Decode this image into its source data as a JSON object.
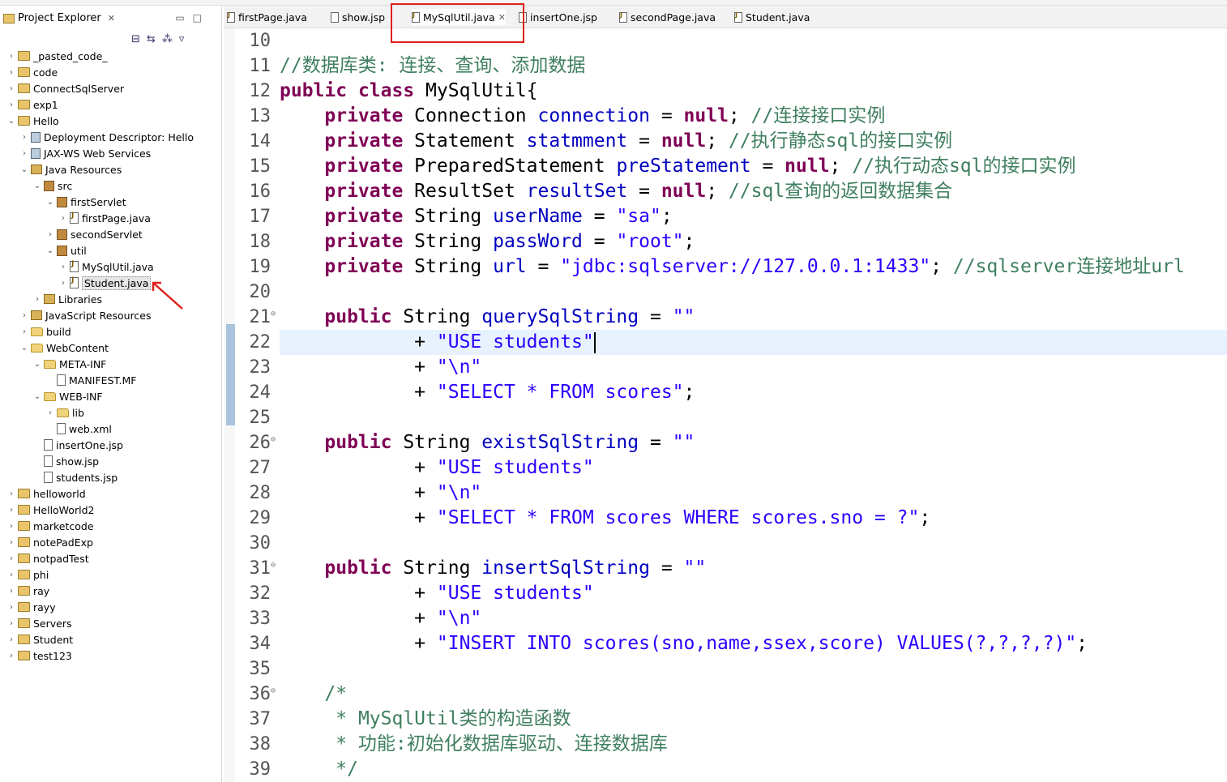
{
  "explorer": {
    "title": "Project Explorer",
    "items": [
      {
        "label": "_pasted_code_",
        "depth": 0,
        "icon": "project-icon",
        "expanded": false
      },
      {
        "label": "code",
        "depth": 0,
        "icon": "project-icon",
        "expanded": false
      },
      {
        "label": "ConnectSqlServer",
        "depth": 0,
        "icon": "project-icon",
        "expanded": false
      },
      {
        "label": "exp1",
        "depth": 0,
        "icon": "project-icon",
        "expanded": false
      },
      {
        "label": "Hello",
        "depth": 0,
        "icon": "project-icon",
        "expanded": true
      },
      {
        "label": "Deployment Descriptor: Hello",
        "depth": 1,
        "icon": "deployment-descriptor-icon",
        "expanded": false
      },
      {
        "label": "JAX-WS Web Services",
        "depth": 1,
        "icon": "web-services-icon",
        "expanded": false
      },
      {
        "label": "Java Resources",
        "depth": 1,
        "icon": "java-resources-icon",
        "expanded": true
      },
      {
        "label": "src",
        "depth": 2,
        "icon": "source-folder-icon",
        "expanded": true
      },
      {
        "label": "firstServlet",
        "depth": 3,
        "icon": "package-icon",
        "expanded": true
      },
      {
        "label": "firstPage.java",
        "depth": 4,
        "icon": "java-file-icon",
        "expanded": false
      },
      {
        "label": "secondServlet",
        "depth": 3,
        "icon": "package-icon",
        "expanded": false
      },
      {
        "label": "util",
        "depth": 3,
        "icon": "package-icon",
        "expanded": true
      },
      {
        "label": "MySqlUtil.java",
        "depth": 4,
        "icon": "java-file-icon",
        "expanded": false
      },
      {
        "label": "Student.java",
        "depth": 4,
        "icon": "java-file-icon",
        "expanded": false,
        "selected": true
      },
      {
        "label": "Libraries",
        "depth": 2,
        "icon": "libraries-icon",
        "expanded": false
      },
      {
        "label": "JavaScript Resources",
        "depth": 1,
        "icon": "javascript-resources-icon",
        "expanded": false
      },
      {
        "label": "build",
        "depth": 1,
        "icon": "folder-icon",
        "expanded": false
      },
      {
        "label": "WebContent",
        "depth": 1,
        "icon": "folder-icon",
        "expanded": true
      },
      {
        "label": "META-INF",
        "depth": 2,
        "icon": "folder-icon",
        "expanded": true
      },
      {
        "label": "MANIFEST.MF",
        "depth": 3,
        "icon": "file-icon",
        "leaf": true
      },
      {
        "label": "WEB-INF",
        "depth": 2,
        "icon": "folder-icon",
        "expanded": true
      },
      {
        "label": "lib",
        "depth": 3,
        "icon": "folder-icon",
        "expanded": false
      },
      {
        "label": "web.xml",
        "depth": 3,
        "icon": "xml-file-icon",
        "leaf": true
      },
      {
        "label": "insertOne.jsp",
        "depth": 2,
        "icon": "file-icon",
        "leaf": true
      },
      {
        "label": "show.jsp",
        "depth": 2,
        "icon": "file-icon",
        "leaf": true
      },
      {
        "label": "students.jsp",
        "depth": 2,
        "icon": "file-icon",
        "leaf": true
      },
      {
        "label": "helloworld",
        "depth": 0,
        "icon": "project-icon",
        "expanded": false
      },
      {
        "label": "HelloWorld2",
        "depth": 0,
        "icon": "project-icon",
        "expanded": false
      },
      {
        "label": "marketcode",
        "depth": 0,
        "icon": "project-icon",
        "expanded": false
      },
      {
        "label": "notePadExp",
        "depth": 0,
        "icon": "project-icon",
        "expanded": false
      },
      {
        "label": "notpadTest",
        "depth": 0,
        "icon": "project-icon",
        "expanded": false
      },
      {
        "label": "phi",
        "depth": 0,
        "icon": "project-icon",
        "expanded": false
      },
      {
        "label": "ray",
        "depth": 0,
        "icon": "project-icon",
        "expanded": false
      },
      {
        "label": "rayy",
        "depth": 0,
        "icon": "project-icon",
        "expanded": false
      },
      {
        "label": "Servers",
        "depth": 0,
        "icon": "project-icon",
        "expanded": false
      },
      {
        "label": "Student",
        "depth": 0,
        "icon": "project-icon",
        "expanded": false
      },
      {
        "label": "test123",
        "depth": 0,
        "icon": "project-icon",
        "expanded": false
      }
    ]
  },
  "editor": {
    "tabs": [
      {
        "label": "firstPage.java",
        "icon": "java-file-icon",
        "active": false
      },
      {
        "label": "show.jsp",
        "icon": "jsp-file-icon",
        "active": false
      },
      {
        "label": "MySqlUtil.java",
        "icon": "java-file-icon",
        "active": true
      },
      {
        "label": "insertOne.jsp",
        "icon": "jsp-file-icon",
        "active": false
      },
      {
        "label": "secondPage.java",
        "icon": "java-file-icon",
        "active": false
      },
      {
        "label": "Student.java",
        "icon": "java-file-icon",
        "active": false
      }
    ],
    "current_line": 22,
    "lines": [
      {
        "n": "10",
        "tokens": []
      },
      {
        "n": "11",
        "tokens": [
          [
            "cmt",
            "//数据库类: 连接、查询、添加数据"
          ]
        ]
      },
      {
        "n": "12",
        "tokens": [
          [
            "kw",
            "public"
          ],
          [
            "",
            " "
          ],
          [
            "kw",
            "class"
          ],
          [
            "",
            " MySqlUtil{"
          ]
        ]
      },
      {
        "n": "13",
        "tokens": [
          [
            "",
            "    "
          ],
          [
            "kw",
            "private"
          ],
          [
            "",
            " Connection "
          ],
          [
            "fld",
            "connection"
          ],
          [
            "",
            " = "
          ],
          [
            "kw",
            "null"
          ],
          [
            "",
            "; "
          ],
          [
            "cmt",
            "//连接接口实例"
          ]
        ]
      },
      {
        "n": "14",
        "tokens": [
          [
            "",
            "    "
          ],
          [
            "kw",
            "private"
          ],
          [
            "",
            " Statement "
          ],
          [
            "fld",
            "statmment"
          ],
          [
            "",
            " = "
          ],
          [
            "kw",
            "null"
          ],
          [
            "",
            "; "
          ],
          [
            "cmt",
            "//执行静态sql的接口实例"
          ]
        ]
      },
      {
        "n": "15",
        "tokens": [
          [
            "",
            "    "
          ],
          [
            "kw",
            "private"
          ],
          [
            "",
            " PreparedStatement "
          ],
          [
            "fld",
            "preStatement"
          ],
          [
            "",
            " = "
          ],
          [
            "kw",
            "null"
          ],
          [
            "",
            "; "
          ],
          [
            "cmt",
            "//执行动态sql的接口实例"
          ]
        ]
      },
      {
        "n": "16",
        "tokens": [
          [
            "",
            "    "
          ],
          [
            "kw",
            "private"
          ],
          [
            "",
            " ResultSet "
          ],
          [
            "fld",
            "resultSet"
          ],
          [
            "",
            " = "
          ],
          [
            "kw",
            "null"
          ],
          [
            "",
            "; "
          ],
          [
            "cmt",
            "//sql查询的返回数据集合"
          ]
        ]
      },
      {
        "n": "17",
        "tokens": [
          [
            "",
            "    "
          ],
          [
            "kw",
            "private"
          ],
          [
            "",
            " String "
          ],
          [
            "fld",
            "userName"
          ],
          [
            "",
            " = "
          ],
          [
            "str",
            "\"sa\""
          ],
          [
            "",
            ";"
          ]
        ]
      },
      {
        "n": "18",
        "tokens": [
          [
            "",
            "    "
          ],
          [
            "kw",
            "private"
          ],
          [
            "",
            " String "
          ],
          [
            "fld",
            "passWord"
          ],
          [
            "",
            " = "
          ],
          [
            "str",
            "\"root\""
          ],
          [
            "",
            ";"
          ]
        ]
      },
      {
        "n": "19",
        "tokens": [
          [
            "",
            "    "
          ],
          [
            "kw",
            "private"
          ],
          [
            "",
            " String "
          ],
          [
            "fld",
            "url"
          ],
          [
            "",
            " = "
          ],
          [
            "str",
            "\"jdbc:sqlserver://127.0.0.1:1433\""
          ],
          [
            "",
            "; "
          ],
          [
            "cmt",
            "//sqlserver连接地址url"
          ]
        ]
      },
      {
        "n": "20",
        "tokens": []
      },
      {
        "n": "21",
        "fold": true,
        "tokens": [
          [
            "",
            "    "
          ],
          [
            "kw",
            "public"
          ],
          [
            "",
            " String "
          ],
          [
            "fld",
            "querySqlString"
          ],
          [
            "",
            " = "
          ],
          [
            "str",
            "\"\""
          ]
        ]
      },
      {
        "n": "22",
        "caret": true,
        "tokens": [
          [
            "",
            "            + "
          ],
          [
            "str",
            "\"USE students\""
          ]
        ]
      },
      {
        "n": "23",
        "tokens": [
          [
            "",
            "            + "
          ],
          [
            "str",
            "\"\\n\""
          ]
        ]
      },
      {
        "n": "24",
        "tokens": [
          [
            "",
            "            + "
          ],
          [
            "str",
            "\"SELECT * FROM scores\""
          ],
          [
            "",
            ";"
          ]
        ]
      },
      {
        "n": "25",
        "tokens": []
      },
      {
        "n": "26",
        "fold": true,
        "tokens": [
          [
            "",
            "    "
          ],
          [
            "kw",
            "public"
          ],
          [
            "",
            " String "
          ],
          [
            "fld",
            "existSqlString"
          ],
          [
            "",
            " = "
          ],
          [
            "str",
            "\"\""
          ]
        ]
      },
      {
        "n": "27",
        "tokens": [
          [
            "",
            "            + "
          ],
          [
            "str",
            "\"USE students\""
          ]
        ]
      },
      {
        "n": "28",
        "tokens": [
          [
            "",
            "            + "
          ],
          [
            "str",
            "\"\\n\""
          ]
        ]
      },
      {
        "n": "29",
        "tokens": [
          [
            "",
            "            + "
          ],
          [
            "str",
            "\"SELECT * FROM scores WHERE scores.sno = ?\""
          ],
          [
            "",
            ";"
          ]
        ]
      },
      {
        "n": "30",
        "tokens": []
      },
      {
        "n": "31",
        "fold": true,
        "tokens": [
          [
            "",
            "    "
          ],
          [
            "kw",
            "public"
          ],
          [
            "",
            " String "
          ],
          [
            "fld",
            "insertSqlString"
          ],
          [
            "",
            " = "
          ],
          [
            "str",
            "\"\""
          ]
        ]
      },
      {
        "n": "32",
        "tokens": [
          [
            "",
            "            + "
          ],
          [
            "str",
            "\"USE students\""
          ]
        ]
      },
      {
        "n": "33",
        "tokens": [
          [
            "",
            "            + "
          ],
          [
            "str",
            "\"\\n\""
          ]
        ]
      },
      {
        "n": "34",
        "tokens": [
          [
            "",
            "            + "
          ],
          [
            "str",
            "\"INSERT INTO scores(sno,name,ssex,score) VALUES(?,?,?,?)\""
          ],
          [
            "",
            ";"
          ]
        ]
      },
      {
        "n": "35",
        "tokens": []
      },
      {
        "n": "36",
        "fold": true,
        "tokens": [
          [
            "",
            "    "
          ],
          [
            "cmt",
            "/*"
          ]
        ]
      },
      {
        "n": "37",
        "tokens": [
          [
            "",
            "     "
          ],
          [
            "cmt",
            "* MySqlUtil类的构造函数"
          ]
        ]
      },
      {
        "n": "38",
        "tokens": [
          [
            "",
            "    "
          ],
          [
            "cmt",
            " * 功能:初始化数据库驱动、连接数据库"
          ]
        ]
      },
      {
        "n": "39",
        "tokens": [
          [
            "",
            "     "
          ],
          [
            "cmt",
            "*/"
          ]
        ]
      }
    ]
  },
  "colors": {
    "keyword": "#7f0055",
    "field": "#0000c0",
    "string": "#2a00ff",
    "comment": "#3f7f5f",
    "annotation_red": "#e0201a",
    "current_line_bg": "#e8f2fe"
  }
}
